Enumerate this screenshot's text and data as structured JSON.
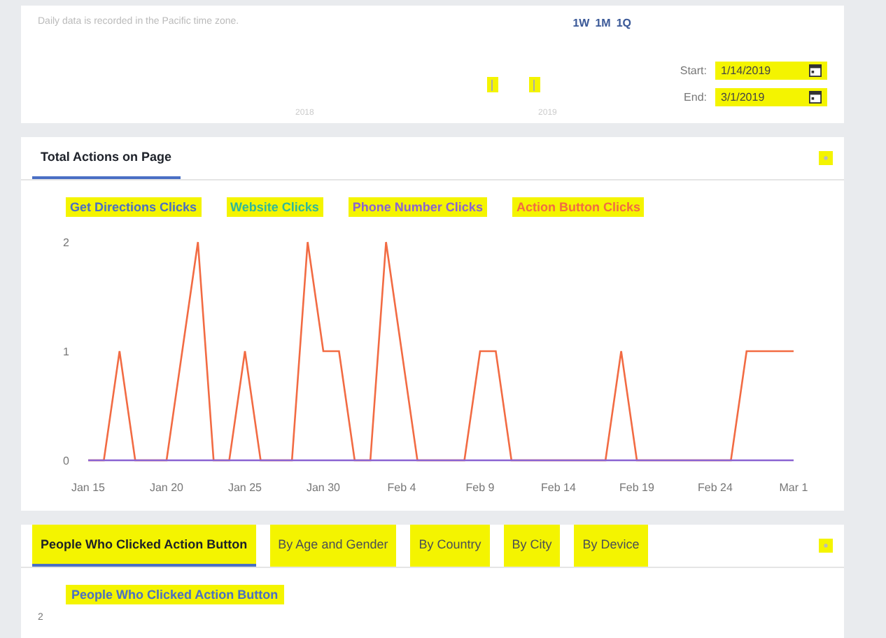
{
  "range_panel": {
    "note": "Daily data is recorded in the Pacific time zone.",
    "presets": [
      {
        "label": "1W"
      },
      {
        "label": "1M"
      },
      {
        "label": "1Q"
      }
    ],
    "timeline_labels": [
      "2018",
      "2019"
    ],
    "handles_highlighted": true,
    "start": {
      "label": "Start:",
      "value": "1/14/2019",
      "highlighted": true
    },
    "end": {
      "label": "End:",
      "value": "3/1/2019",
      "highlighted": true
    }
  },
  "actions_panel": {
    "tabs": [
      {
        "label": "Total Actions on Page",
        "selected": true,
        "highlighted": false
      }
    ],
    "settings_highlighted": true,
    "legend_highlighted": true,
    "chart_data": {
      "type": "line",
      "ylim": [
        0,
        2
      ],
      "yticks": [
        0,
        1,
        2
      ],
      "categories": [
        "Jan 15",
        null,
        null,
        null,
        null,
        "Jan 20",
        null,
        null,
        null,
        null,
        "Jan 25",
        null,
        null,
        null,
        null,
        "Jan 30",
        null,
        null,
        null,
        null,
        "Feb 4",
        null,
        null,
        null,
        null,
        "Feb 9",
        null,
        null,
        null,
        null,
        "Feb 14",
        null,
        null,
        null,
        null,
        "Feb 19",
        null,
        null,
        null,
        null,
        "Feb 24",
        null,
        null,
        null,
        null,
        "Mar 1"
      ],
      "series": [
        {
          "name": "Get Directions Clicks",
          "color": "#4a6fc4",
          "values": [
            null,
            null,
            null,
            null,
            null,
            null,
            null,
            null,
            null,
            null,
            null,
            null,
            null,
            null,
            null,
            null,
            null,
            null,
            null,
            null,
            null,
            null,
            null,
            null,
            null,
            null,
            null,
            null,
            null,
            null,
            null,
            null,
            null,
            null,
            null,
            null,
            null,
            null,
            null,
            null,
            null,
            null,
            null,
            null,
            null,
            null
          ]
        },
        {
          "name": "Website Clicks",
          "color": "#2fb89a",
          "values": [
            null,
            null,
            null,
            null,
            null,
            null,
            null,
            null,
            null,
            null,
            null,
            null,
            null,
            null,
            null,
            null,
            null,
            null,
            null,
            null,
            null,
            null,
            null,
            null,
            null,
            null,
            null,
            null,
            null,
            null,
            null,
            null,
            null,
            null,
            null,
            null,
            null,
            null,
            null,
            null,
            null,
            null,
            null,
            null,
            null,
            null
          ]
        },
        {
          "name": "Phone Number Clicks",
          "color": "#8a63d2",
          "values": [
            0,
            0,
            0,
            0,
            0,
            0,
            0,
            0,
            0,
            0,
            0,
            0,
            0,
            0,
            0,
            0,
            0,
            0,
            0,
            0,
            0,
            0,
            0,
            0,
            0,
            0,
            0,
            0,
            0,
            0,
            0,
            0,
            0,
            0,
            0,
            0,
            0,
            0,
            0,
            0,
            0,
            0,
            0,
            0,
            0,
            0
          ]
        },
        {
          "name": "Action Button Clicks",
          "color": "#f26b43",
          "values": [
            0,
            0,
            1,
            0,
            0,
            0,
            1,
            2,
            0,
            0,
            1,
            0,
            0,
            0,
            2,
            1,
            1,
            0,
            0,
            2,
            1,
            0,
            0,
            0,
            0,
            1,
            1,
            0,
            0,
            0,
            0,
            0,
            0,
            0,
            1,
            0,
            0,
            0,
            0,
            0,
            0,
            0,
            1,
            1,
            1,
            1
          ]
        }
      ]
    }
  },
  "people_panel": {
    "tabs": [
      {
        "label": "People Who Clicked Action Button",
        "selected": true,
        "highlighted": true
      },
      {
        "label": "By Age and Gender",
        "selected": false,
        "highlighted": true
      },
      {
        "label": "By Country",
        "selected": false,
        "highlighted": true
      },
      {
        "label": "By City",
        "selected": false,
        "highlighted": true
      },
      {
        "label": "By Device",
        "selected": false,
        "highlighted": true
      }
    ],
    "settings_highlighted": true,
    "legend": {
      "label": "People Who Clicked Action Button",
      "highlighted": true
    },
    "y_tick": "2"
  }
}
